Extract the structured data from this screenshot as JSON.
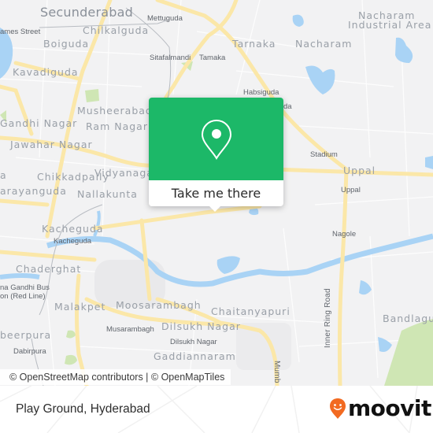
{
  "map": {
    "labels": {
      "secunderabad": "Secunderabad",
      "mettuguda": "Mettuguda",
      "james_street": "ames Street",
      "chilkalguda": "Chilkalguda",
      "boiguda": "Boiguda",
      "sitafalmandi": "Sitafalmandi",
      "tarnaka_small": "Tamaka",
      "tarnaka": "Tarnaka",
      "nacharam": "Nacharam",
      "nacharam_ind_1": "Nacharam",
      "nacharam_ind_2": "Industrial Area",
      "kavadiguda": "Kavadiguda",
      "habsiguda": "Habsiguda",
      "habsiguda_partial": "da",
      "musheerabad": "Musheerabad",
      "gandhi_nagar": "Gandhi Nagar",
      "ram_nagar": "Ram Nagar",
      "jawahar_nagar": "Jawahar Nagar",
      "stadium": "Stadium",
      "uppal": "Uppal",
      "uppal_small": "Uppal",
      "chikkadpally": "Chikkadpally",
      "vidyanagar": "Vidyanagar",
      "left_da": "a",
      "narayanguda": "arayanguda",
      "nallakunta": "Nallakunta",
      "kacheguda": "Kacheguda",
      "kacheguda_small": "Kacheguda",
      "nagole": "Nagole",
      "chaderghat": "Chaderghat",
      "mgbs_1": "na Gandhi Bus",
      "mgbs_2": "on (Red Line)",
      "malakpet": "Malakpet",
      "moosarambagh": "Moosarambagh",
      "chaitanyapuri": "Chaitanyapuri",
      "inner_ring_road": "Inner Ring Road",
      "bandlaguda": "Bandlaguda",
      "musarambagh": "Musarambagh",
      "dilsukh_nagar": "Dilsukh Nagar",
      "dilsukh_nagar_small": "Dilsukh Nagar",
      "azampura": "beerpura",
      "dabirpura": "Dabirpura",
      "gaddiannaram": "Gaddiannaram",
      "mumbai_hwy": "Mumb"
    },
    "attribution": "© OpenStreetMap contributors | © OpenMapTiles",
    "colors": {
      "land": "#f2f2f3",
      "road_major": "#fbe7a8",
      "water": "#a9d3f5",
      "park": "#cfe6b4"
    }
  },
  "popup": {
    "icon": "location-pin-icon",
    "button_label": "Take me there",
    "color": "#1cb868"
  },
  "footer": {
    "place_title": "Play Ground, Hyderabad",
    "logo_text": "moovit",
    "logo_color": "#f26a21"
  }
}
